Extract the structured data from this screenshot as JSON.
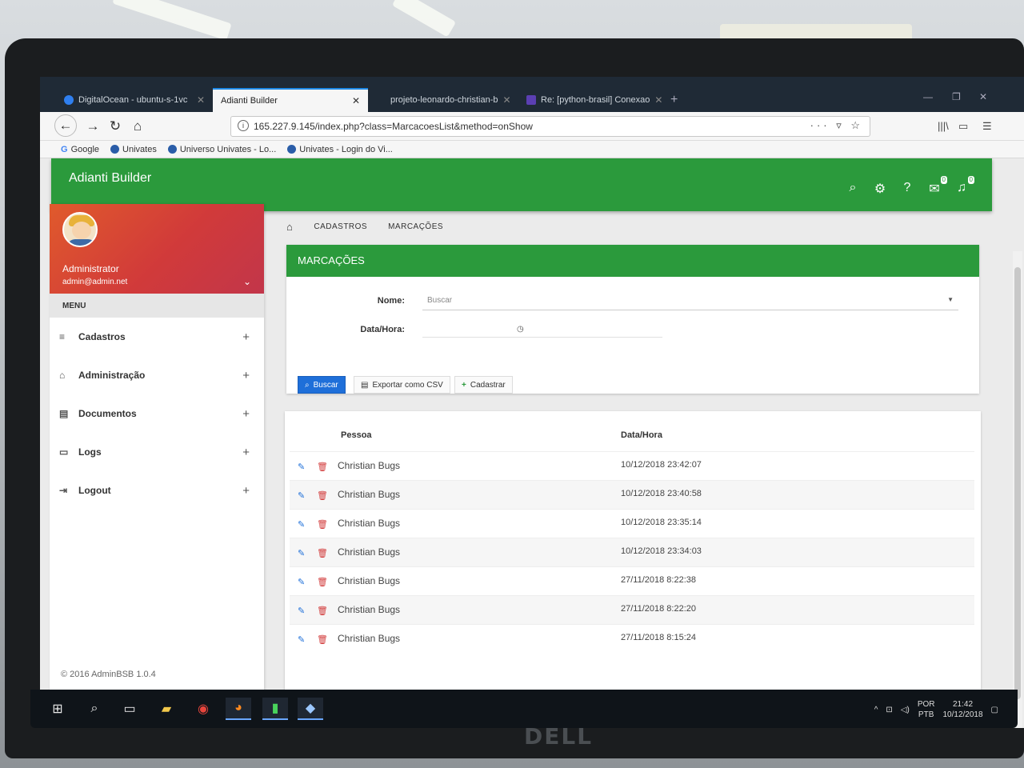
{
  "browser": {
    "tabs": [
      {
        "label": "DigitalOcean - ubuntu-s-1vc",
        "active": false
      },
      {
        "label": "Adianti Builder",
        "active": true
      },
      {
        "label": "projeto-leonardo-christian-b",
        "active": false
      },
      {
        "label": "Re: [python-brasil] Conexao",
        "active": false
      }
    ],
    "new_tab": "+",
    "url": "165.227.9.145/index.php?class=MarcacoesList&method=onShow",
    "bookmarks": [
      "Google",
      "Univates",
      "Universo Univates - Lo...",
      "Univates - Login do Vi..."
    ]
  },
  "app": {
    "title": "Adianti Builder",
    "notif_badges": {
      "messages": "0",
      "alerts": "0"
    },
    "accent": "#2b9a3c"
  },
  "sidebar": {
    "user_name": "Administrator",
    "user_email": "admin@admin.net",
    "menu_title": "MENU",
    "items": [
      {
        "label": "Cadastros",
        "icon": "list-icon"
      },
      {
        "label": "Administração",
        "icon": "bank-icon"
      },
      {
        "label": "Documentos",
        "icon": "document-icon"
      },
      {
        "label": "Logs",
        "icon": "monitor-icon"
      },
      {
        "label": "Logout",
        "icon": "sign-out-icon"
      }
    ],
    "expand_symbol": "+",
    "copyright": "© 2016 AdminBSB 1.0.4"
  },
  "breadcrumb": [
    "CADASTROS",
    "MARCAÇÕES"
  ],
  "form": {
    "title": "MARCAÇÕES",
    "nome_label": "Nome:",
    "nome_placeholder": "Buscar",
    "datahora_label": "Data/Hora:",
    "buttons": {
      "search": "Buscar",
      "export": "Exportar como CSV",
      "create": "Cadastrar"
    }
  },
  "grid": {
    "columns": [
      "Pessoa",
      "Data/Hora"
    ],
    "rows": [
      {
        "pessoa": "Christian Bugs",
        "datahora": "10/12/2018 23:42:07"
      },
      {
        "pessoa": "Christian Bugs",
        "datahora": "10/12/2018 23:40:58"
      },
      {
        "pessoa": "Christian Bugs",
        "datahora": "10/12/2018 23:35:14"
      },
      {
        "pessoa": "Christian Bugs",
        "datahora": "10/12/2018 23:34:03"
      },
      {
        "pessoa": "Christian Bugs",
        "datahora": "27/11/2018 8:22:38"
      },
      {
        "pessoa": "Christian Bugs",
        "datahora": "27/11/2018 8:22:20"
      },
      {
        "pessoa": "Christian Bugs",
        "datahora": "27/11/2018 8:15:24"
      }
    ]
  },
  "taskbar": {
    "lang_top": "POR",
    "lang_bottom": "PTB",
    "time": "21:42",
    "date": "10/12/2018"
  },
  "monitor_brand": "DELL"
}
